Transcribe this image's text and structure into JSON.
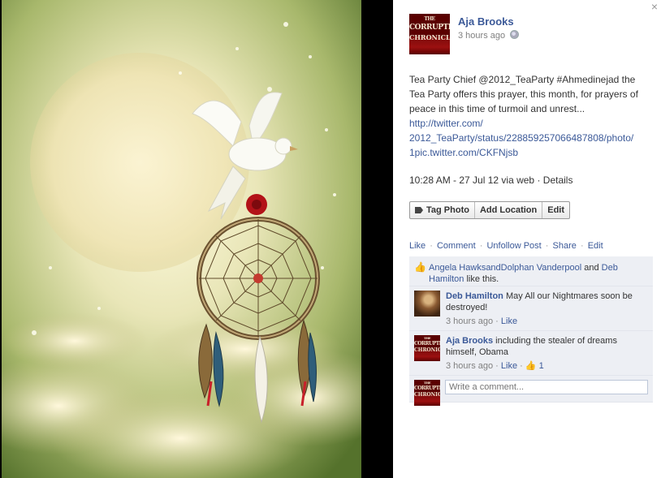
{
  "post": {
    "author": "Aja Brooks",
    "time": "3 hours ago",
    "avatar_text": [
      "THE",
      "CORRUPTION",
      "CHRONICLES"
    ],
    "caption_text": "Tea Party Chief @2012_TeaParty #Ahmedinejad the Tea Party offers this prayer, this month, for prayers of peace in this time of turmoil and unrest...",
    "caption_link_1": "http://twitter.com/",
    "caption_link_2": "2012_TeaParty/status/228859257066487808/photo/",
    "caption_link_3": "1pic.twitter.com/CKFNjsb",
    "meta_time": "10:28 AM - 27 Jul 12 via web",
    "meta_details": "Details"
  },
  "photo_actions": {
    "tag_photo": "Tag Photo",
    "add_location": "Add Location",
    "edit": "Edit"
  },
  "actions": {
    "like": "Like",
    "comment": "Comment",
    "unfollow": "Unfollow Post",
    "share": "Share",
    "edit": "Edit",
    "separator": "·"
  },
  "likes": {
    "person_1": "Angela HawksandDolphan Vanderpool",
    "and": "and",
    "person_2": "Deb Hamilton",
    "suffix": "like this."
  },
  "comments": [
    {
      "name": "Deb Hamilton",
      "text": "May All our Nightmares soon be destroyed!",
      "time": "3 hours ago",
      "like": "Like"
    },
    {
      "name": "Aja Brooks",
      "text": "including the stealer of dreams himself, Obama",
      "time": "3 hours ago",
      "like": "Like",
      "like_count": "1"
    }
  ],
  "composer": {
    "placeholder": "Write a comment..."
  },
  "close_glyph": "×",
  "dot": "·",
  "colors": {
    "link": "#3b5998",
    "ufi_bg": "#edeff4",
    "photo_border": "#000000"
  }
}
